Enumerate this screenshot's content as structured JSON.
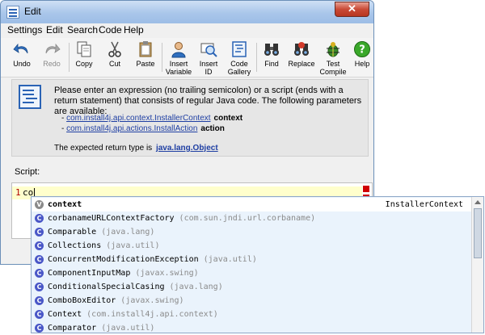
{
  "window": {
    "title": "Edit",
    "close_glyph": "✕"
  },
  "menu": [
    "Settings",
    "Edit",
    "Search",
    "Code",
    "Help"
  ],
  "toolbar": [
    {
      "label1": "Undo",
      "label2": "",
      "icon": "undo-icon",
      "enabled": true
    },
    {
      "label1": "Redo",
      "label2": "",
      "icon": "redo-icon",
      "enabled": false
    },
    {
      "label1": "Copy",
      "label2": "",
      "icon": "copy-icon",
      "enabled": true
    },
    {
      "label1": "Cut",
      "label2": "",
      "icon": "scissors-icon",
      "enabled": true
    },
    {
      "label1": "Paste",
      "label2": "",
      "icon": "clipboard-icon",
      "enabled": true
    },
    {
      "label1": "Insert",
      "label2": "Variable",
      "icon": "user-icon",
      "enabled": true
    },
    {
      "label1": "Insert",
      "label2": "ID",
      "icon": "id-magnifier-icon",
      "enabled": true
    },
    {
      "label1": "Code",
      "label2": "Gallery",
      "icon": "code-gallery-icon",
      "enabled": true
    },
    {
      "label1": "Find",
      "label2": "",
      "icon": "binoculars-icon",
      "enabled": true
    },
    {
      "label1": "Replace",
      "label2": "",
      "icon": "replace-icon",
      "enabled": true
    },
    {
      "label1": "Test",
      "label2": "Compile",
      "icon": "bug-icon",
      "enabled": true
    },
    {
      "label1": "Help",
      "label2": "",
      "icon": "help-icon",
      "enabled": true
    }
  ],
  "info": {
    "description": "Please enter an expression (no trailing semicolon) or a script (ends with a return statement) that consists of regular Java code. The following parameters are available:",
    "params": [
      {
        "type": "com.install4j.api.context.InstallerContext",
        "name": "context"
      },
      {
        "type": "com.install4j.api.actions.InstallAction",
        "name": "action"
      }
    ],
    "return_prefix": "The expected return type is",
    "return_type": "java.lang.Object"
  },
  "editor": {
    "label": "Script:",
    "line_number": "1",
    "code": "co"
  },
  "completions": [
    {
      "kind": "V",
      "name": "context",
      "package": "",
      "type": "InstallerContext"
    },
    {
      "kind": "C",
      "name": "corbanameURLContextFactory",
      "package": "(com.sun.jndi.url.corbaname)",
      "type": ""
    },
    {
      "kind": "C",
      "name": "Comparable",
      "package": "(java.lang)",
      "type": ""
    },
    {
      "kind": "C",
      "name": "Collections",
      "package": "(java.util)",
      "type": ""
    },
    {
      "kind": "C",
      "name": "ConcurrentModificationException",
      "package": "(java.util)",
      "type": ""
    },
    {
      "kind": "C",
      "name": "ComponentInputMap",
      "package": "(javax.swing)",
      "type": ""
    },
    {
      "kind": "C",
      "name": "ConditionalSpecialCasing",
      "package": "(java.lang)",
      "type": ""
    },
    {
      "kind": "C",
      "name": "ComboBoxEditor",
      "package": "(javax.swing)",
      "type": ""
    },
    {
      "kind": "C",
      "name": "Context",
      "package": "(com.install4j.api.context)",
      "type": ""
    },
    {
      "kind": "C",
      "name": "Comparator",
      "package": "(java.util)",
      "type": ""
    }
  ]
}
